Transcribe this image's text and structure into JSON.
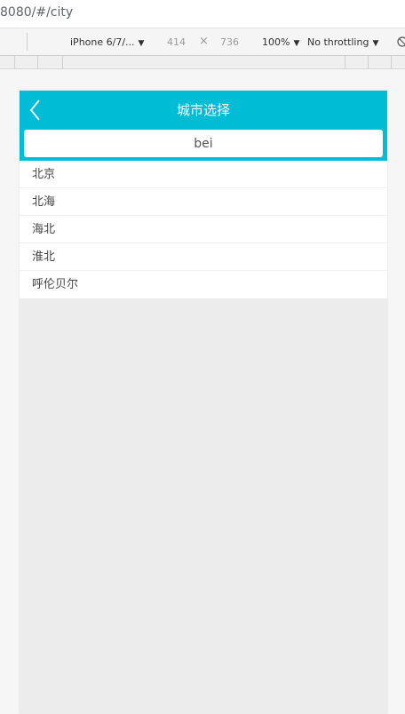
{
  "browser": {
    "url": "8080/#/city"
  },
  "devtools": {
    "device": "iPhone 6/7/...",
    "width": "414",
    "times": "×",
    "height": "736",
    "zoom": "100%",
    "throttling": "No throttling",
    "caret": "▼"
  },
  "page": {
    "title": "城市选择",
    "search_value": "bei",
    "cities": [
      "北京",
      "北海",
      "海北",
      "淮北",
      "呼伦贝尔"
    ],
    "header_color": "#00bcd4"
  }
}
